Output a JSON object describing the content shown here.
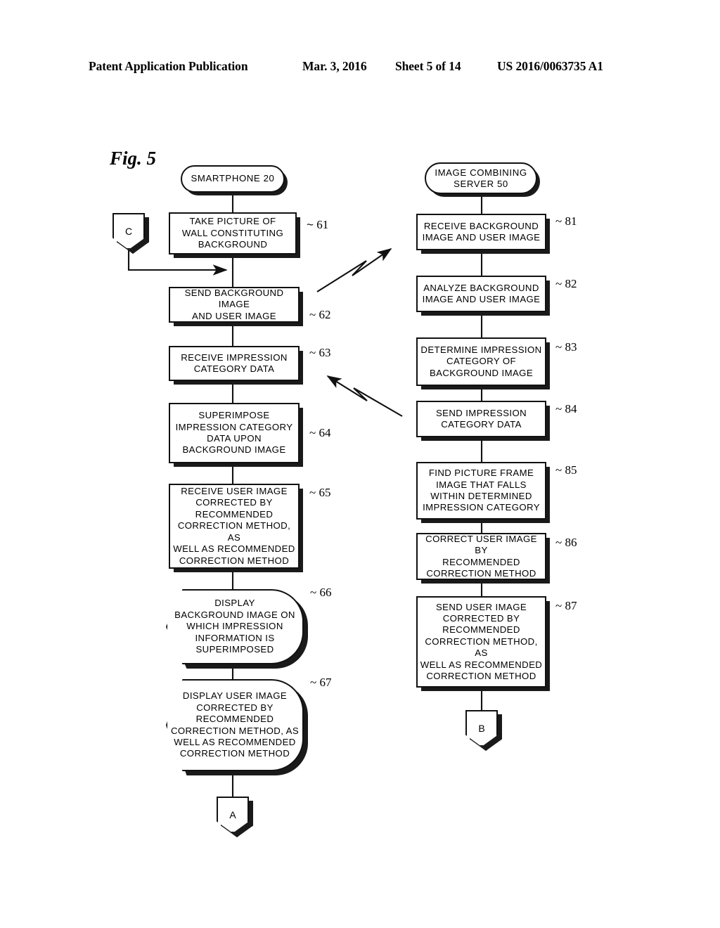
{
  "header": {
    "publication": "Patent Application Publication",
    "date": "Mar. 3, 2016",
    "sheet": "Sheet 5 of 14",
    "docnum": "US 2016/0063735 A1"
  },
  "figure": {
    "label": "Fig. 5",
    "lanes": [
      {
        "id": "smartphone",
        "title": "SMARTPHONE 20"
      },
      {
        "id": "server",
        "title": "IMAGE COMBINING\nSERVER 50"
      }
    ],
    "left_column": {
      "terminator": "SMARTPHONE 20",
      "entry_connector": "C",
      "exit_connector": "A",
      "steps": [
        {
          "ref": "61",
          "kind": "process",
          "text": "TAKE PICTURE OF\nWALL CONSTITUTING\nBACKGROUND"
        },
        {
          "ref": "62",
          "kind": "process",
          "text": "SEND BACKGROUND IMAGE\nAND USER IMAGE"
        },
        {
          "ref": "63",
          "kind": "process",
          "text": "RECEIVE IMPRESSION\nCATEGORY DATA"
        },
        {
          "ref": "64",
          "kind": "process",
          "text": "SUPERIMPOSE\nIMPRESSION CATEGORY\nDATA UPON\nBACKGROUND IMAGE"
        },
        {
          "ref": "65",
          "kind": "process",
          "text": "RECEIVE USER IMAGE\nCORRECTED BY\nRECOMMENDED\nCORRECTION METHOD, AS\nWELL AS RECOMMENDED\nCORRECTION METHOD"
        },
        {
          "ref": "66",
          "kind": "display",
          "text": "DISPLAY\nBACKGROUND IMAGE ON\nWHICH IMPRESSION\nINFORMATION IS\nSUPERIMPOSED"
        },
        {
          "ref": "67",
          "kind": "display",
          "text": "DISPLAY USER IMAGE\nCORRECTED BY\nRECOMMENDED\nCORRECTION METHOD, AS\nWELL AS RECOMMENDED\nCORRECTION METHOD"
        }
      ]
    },
    "right_column": {
      "terminator": "IMAGE COMBINING\nSERVER 50",
      "exit_connector": "B",
      "steps": [
        {
          "ref": "81",
          "kind": "process",
          "text": "RECEIVE BACKGROUND\nIMAGE AND USER IMAGE"
        },
        {
          "ref": "82",
          "kind": "process",
          "text": "ANALYZE BACKGROUND\nIMAGE AND USER IMAGE"
        },
        {
          "ref": "83",
          "kind": "process",
          "text": "DETERMINE IMPRESSION\nCATEGORY OF\nBACKGROUND IMAGE"
        },
        {
          "ref": "84",
          "kind": "process",
          "text": "SEND IMPRESSION\nCATEGORY DATA"
        },
        {
          "ref": "85",
          "kind": "process",
          "text": "FIND PICTURE FRAME\nIMAGE THAT FALLS\nWITHIN DETERMINED\nIMPRESSION CATEGORY"
        },
        {
          "ref": "86",
          "kind": "process",
          "text": "CORRECT USER IMAGE BY\nRECOMMENDED\nCORRECTION METHOD"
        },
        {
          "ref": "87",
          "kind": "process",
          "text": "SEND USER IMAGE\nCORRECTED BY\nRECOMMENDED\nCORRECTION METHOD, AS\nWELL AS RECOMMENDED\nCORRECTION METHOD"
        }
      ]
    },
    "cross_links": [
      {
        "from": "62",
        "to": "81",
        "style": "zigzag-arrow",
        "direction": "left-to-right"
      },
      {
        "from": "84",
        "to": "63",
        "style": "zigzag-arrow",
        "direction": "right-to-left"
      }
    ],
    "colors": {
      "ink": "#111111",
      "shadow": "#1a1a1a",
      "paper": "#ffffff"
    }
  }
}
